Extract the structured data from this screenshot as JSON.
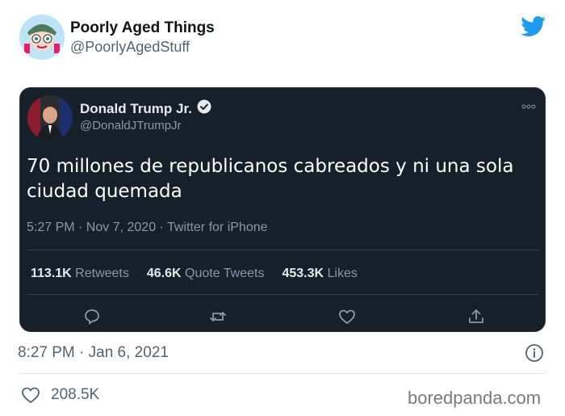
{
  "outer": {
    "name": "Poorly Aged Things",
    "handle": "@PoorlyAgedStuff",
    "time": "8:27 PM · Jan 6, 2021",
    "likes": "208.5K",
    "twitter_color": "#1d9bf0"
  },
  "embedded": {
    "name": "Donald Trump Jr.",
    "handle": "@DonaldJTrumpJr",
    "text": "70 millones de republicanos cabreados y ni una sola ciudad quemada",
    "meta": "5:27 PM · Nov 7, 2020 · Twitter for iPhone",
    "stats": [
      {
        "value": "113.1K",
        "label": "Retweets"
      },
      {
        "value": "46.6K",
        "label": "Quote Tweets"
      },
      {
        "value": "453.3K",
        "label": "Likes"
      }
    ]
  },
  "watermark": "boredpanda.com"
}
